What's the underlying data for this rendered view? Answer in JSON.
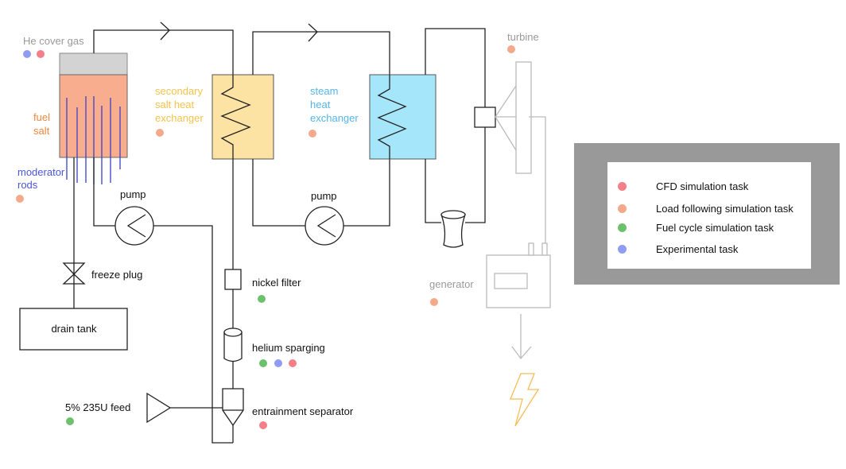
{
  "colors": {
    "cfd": "#f47f88",
    "load": "#f4a98a",
    "fuel_cycle": "#6cc26c",
    "experimental": "#8f9cf2",
    "fuel_salt_fill": "#f9ad8f",
    "secondary_fill": "#fde3a3",
    "steam_fill": "#a6e6fb",
    "rod_color": "#3b41c4",
    "fuel_text": "#f0873f",
    "secondary_text": "#f5c34c",
    "steam_text": "#56b5e8",
    "grey_text": "#9a9a9a",
    "bolt": "#f5bd56"
  },
  "labels": {
    "he_cover_gas": "He cover gas",
    "fuel": "fuel",
    "salt": "salt",
    "moderator": "moderator",
    "rods": "rods",
    "secondary_line1": "secondary",
    "secondary_line2": "salt heat",
    "secondary_line3": "exchanger",
    "steam_line1": "steam",
    "steam_line2": "heat",
    "steam_line3": "exchanger",
    "turbine": "turbine",
    "pump_left": "pump",
    "pump_right": "pump",
    "freeze_plug": "freeze plug",
    "drain_tank": "drain tank",
    "nickel_filter": "nickel filter",
    "helium_sparging": "helium sparging",
    "entrainment_separator": "entrainment separator",
    "feed": "5% 235U feed",
    "generator": "generator"
  },
  "legend": {
    "items": [
      {
        "label": "CFD simulation task",
        "color": "#f47f88"
      },
      {
        "label": "Load following simulation task",
        "color": "#f4a98a"
      },
      {
        "label": "Fuel cycle simulation task",
        "color": "#6cc26c"
      },
      {
        "label": "Experimental task",
        "color": "#8f9cf2"
      }
    ]
  }
}
